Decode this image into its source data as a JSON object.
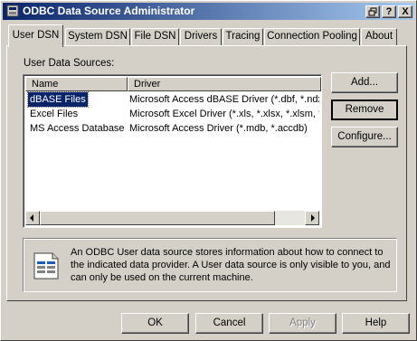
{
  "window": {
    "title": "ODBC Data Source Administrator",
    "controls": {
      "help": "?",
      "close": "X"
    }
  },
  "tabs": [
    {
      "label": "User DSN",
      "active": true
    },
    {
      "label": "System DSN",
      "active": false
    },
    {
      "label": "File DSN",
      "active": false
    },
    {
      "label": "Drivers",
      "active": false
    },
    {
      "label": "Tracing",
      "active": false
    },
    {
      "label": "Connection Pooling",
      "active": false
    },
    {
      "label": "About",
      "active": false
    }
  ],
  "user_dsn": {
    "section_label": "User Data Sources:",
    "columns": {
      "name": "Name",
      "driver": "Driver"
    },
    "rows": [
      {
        "name": "dBASE Files",
        "driver": "Microsoft Access dBASE Driver (*.dbf, *.ndx",
        "selected": true
      },
      {
        "name": "Excel Files",
        "driver": "Microsoft Excel Driver (*.xls, *.xlsx, *.xlsm, *.x",
        "selected": false
      },
      {
        "name": "MS Access Database",
        "driver": "Microsoft Access Driver (*.mdb, *.accdb)",
        "selected": false
      }
    ],
    "buttons": {
      "add": "Add...",
      "remove": "Remove",
      "configure": "Configure..."
    },
    "info_text": "An ODBC User data source stores information about how to connect to the indicated data provider.   A User data source is only visible to you, and can only be used on the current machine."
  },
  "footer": {
    "ok": "OK",
    "cancel": "Cancel",
    "apply": "Apply",
    "help": "Help"
  },
  "icons": {
    "app": "odbc-app-icon",
    "info": "data-source-info-icon",
    "scroll_left": "scroll-left-arrow-icon",
    "scroll_right": "scroll-right-arrow-icon"
  },
  "colors": {
    "titlebar_start": "#0a246a",
    "titlebar_end": "#a6caf0",
    "face": "#d4d0c8",
    "selection": "#0a246a"
  }
}
